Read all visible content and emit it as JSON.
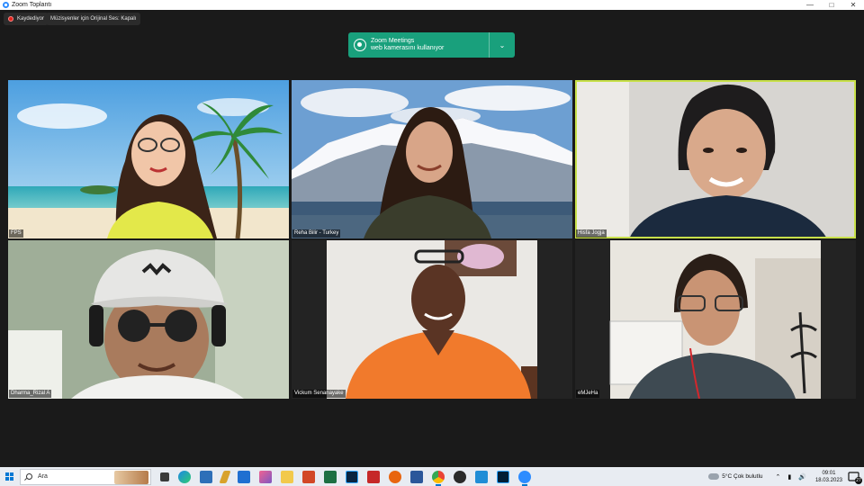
{
  "window": {
    "title": "Zoom Toplantı",
    "controls": [
      "minimize-icon",
      "maximize-icon",
      "close-icon"
    ]
  },
  "status": {
    "recording_label": "Kaydediyor",
    "original_sound_label": "Müzisyenler için Orijinal Ses: Kapalı"
  },
  "banner": {
    "line1": "Zoom Meetings",
    "line2": "web kamerasını kullanıyor",
    "icon": "webcam-icon",
    "color": "#19a07c"
  },
  "participants": [
    {
      "name": "FPS",
      "active": false
    },
    {
      "name": "Reha Bilir - Turkey",
      "active": false
    },
    {
      "name": "Hisfa Jogja",
      "active": true
    },
    {
      "name": "Dharma_Rizal A",
      "active": false
    },
    {
      "name": "Vickum Senanayake",
      "active": false
    },
    {
      "name": "eMJeHa",
      "active": false
    }
  ],
  "active_speaker_color": "#c8e04a",
  "taskbar": {
    "search_placeholder": "Ara",
    "weather": "5°C  Çok bulutlu",
    "time": "09:01",
    "date": "18.03.2023",
    "notification_count": "27"
  }
}
